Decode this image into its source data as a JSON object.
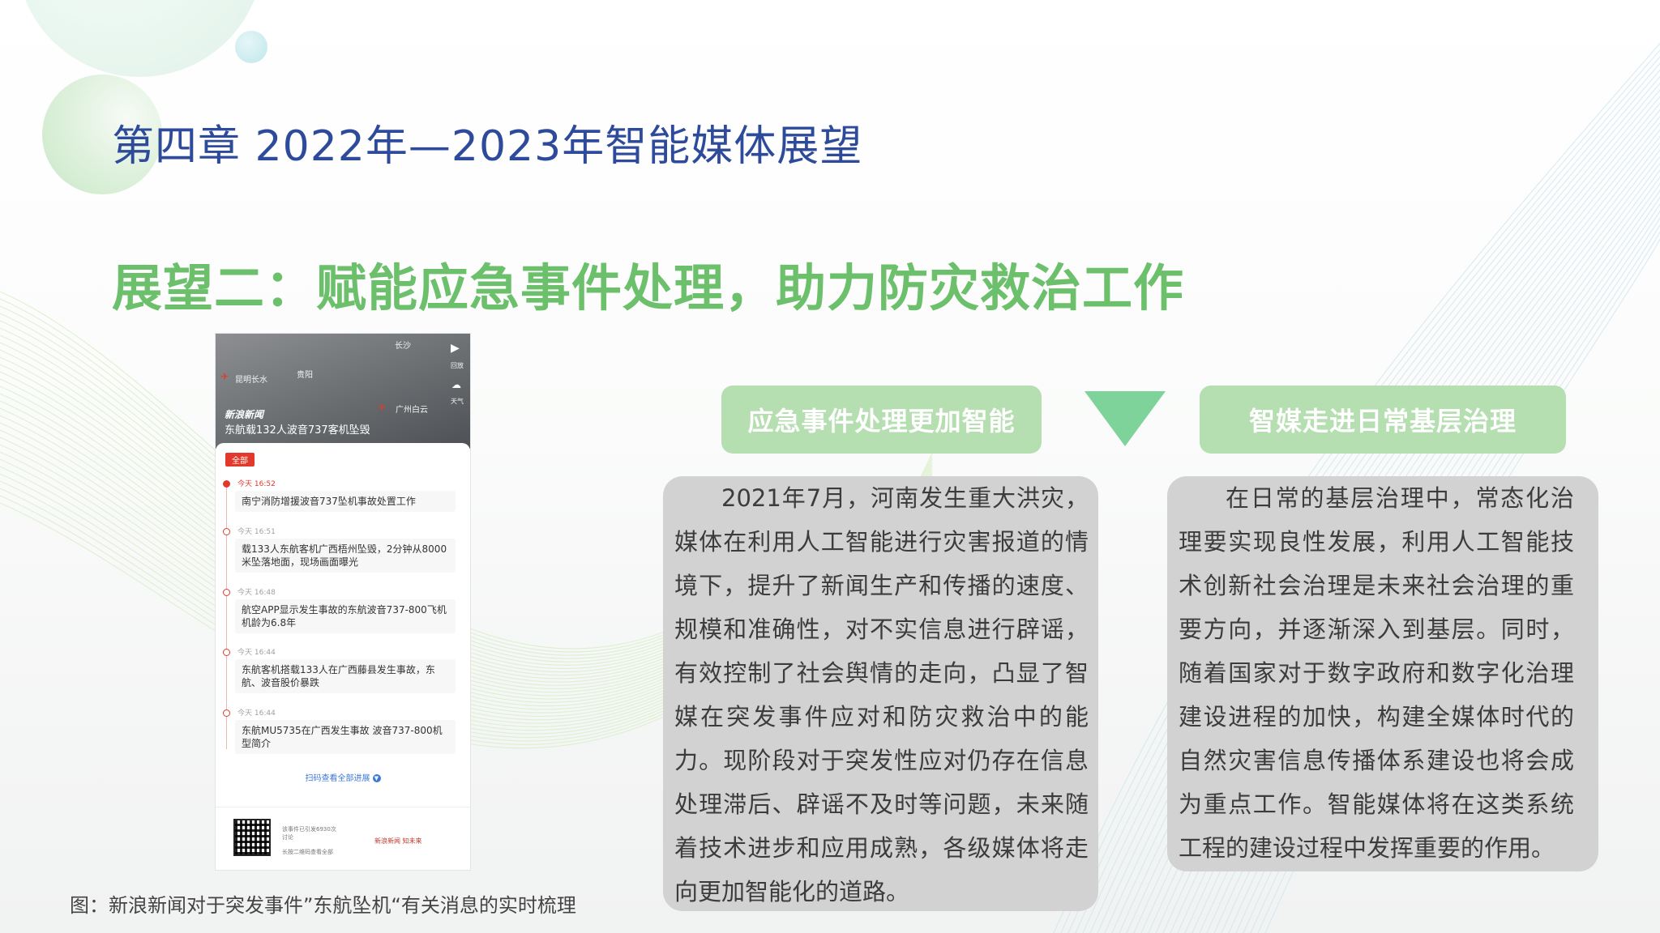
{
  "slide": {
    "chapter_title": "第四章  2022年—2023年智能媒体展望",
    "headline": "展望二：赋能应急事件处理，助力防灾救治工作",
    "caption": "图：新浪新闻对于突发事件”东航坠机“有关消息的实时梳理"
  },
  "left_panel": {
    "title": "应急事件处理更加智能",
    "body": "2021年7月，河南发生重大洪灾，媒体在利用人工智能进行灾害报道的情境下，提升了新闻生产和传播的速度、规模和准确性，对不实信息进行辟谣，有效控制了社会舆情的走向，凸显了智媒在突发事件应对和防灾救治中的能力。现阶段对于突发性应对仍存在信息处理滞后、辟谣不及时等问题，未来随着技术进步和应用成熟，各级媒体将走向更加智能化的道路。"
  },
  "right_panel": {
    "title": "智媒走进日常基层治理",
    "body": "在日常的基层治理中，常态化治理要实现良性发展，利用人工智能技术创新社会治理是未来社会治理的重要方向，并逐渐深入到基层。同时，随着国家对于数字政府和数字化治理建设进程的加快，构建全媒体时代的自然灾害信息传播体系建设也将会成为重点工作。智能媒体将在这类系统工程的建设过程中发挥重要的作用。"
  },
  "phone": {
    "map_labels": {
      "changsha": "长沙",
      "kunming": "昆明长水",
      "guiyang": "贵阳",
      "guangzhou": "广州白云",
      "side_a": "回放",
      "side_b": "天气"
    },
    "brand": "新浪新闻",
    "map_headline": "东航载132人波音737客机坠毁",
    "all_badge": "全部",
    "timeline": [
      {
        "time": "今天 16:52",
        "text": "南宁消防增援波音737坠机事故处置工作",
        "active": true
      },
      {
        "time": "今天 16:51",
        "text": "载133人东航客机广西梧州坠毁，2分钟从8000米坠落地面，现场画面曝光",
        "active": false
      },
      {
        "time": "今天 16:48",
        "text": "航空APP显示发生事故的东航波音737-800飞机机龄为6.8年",
        "active": false
      },
      {
        "time": "今天 16:44",
        "text": "东航客机搭载133人在广西藤县发生事故，东航、波音股价暴跌",
        "active": false
      },
      {
        "time": "今天 16:44",
        "text": "东航MU5735在广西发生事故 波音737-800机型简介",
        "active": false
      }
    ],
    "expand_link": "扫码查看全部进展",
    "footer_line1": "该事件已引发6930次",
    "footer_line2": "讨论",
    "footer_line3": "长按二维码查看全部",
    "footer_logo": "新浪新闻  知未来"
  },
  "colors": {
    "chapter_title": "#2e4a9a",
    "headline": "#6cc06c",
    "pill": "#b6dfb1",
    "triangle": "#7ed39b",
    "panel": "#d2d2d2",
    "accent_red": "#e2392d"
  }
}
